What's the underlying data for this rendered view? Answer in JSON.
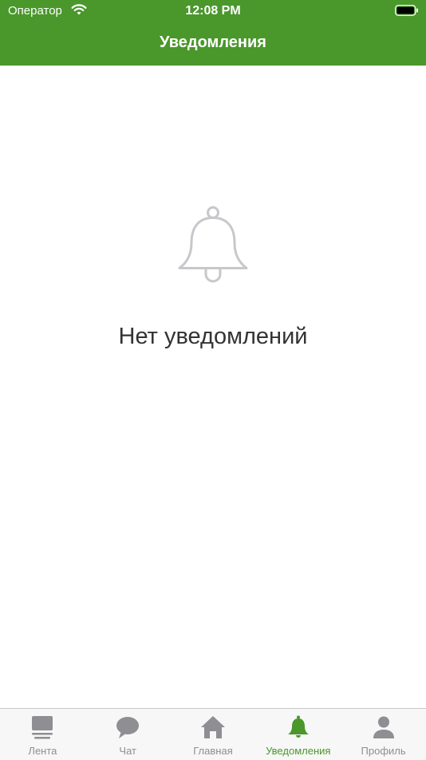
{
  "status_bar": {
    "carrier": "Оператор",
    "time": "12:08 PM"
  },
  "header": {
    "title": "Уведомления"
  },
  "empty_state": {
    "icon": "bell-icon",
    "message": "Нет уведомлений"
  },
  "tabs": [
    {
      "label": "Лента",
      "icon": "feed-icon",
      "active": false
    },
    {
      "label": "Чат",
      "icon": "chat-bubble-icon",
      "active": false
    },
    {
      "label": "Главная",
      "icon": "home-icon",
      "active": false
    },
    {
      "label": "Уведомления",
      "icon": "bell-icon",
      "active": true
    },
    {
      "label": "Профиль",
      "icon": "person-icon",
      "active": false
    }
  ],
  "colors": {
    "accent": "#4a972b",
    "inactive": "#8e8e93"
  }
}
